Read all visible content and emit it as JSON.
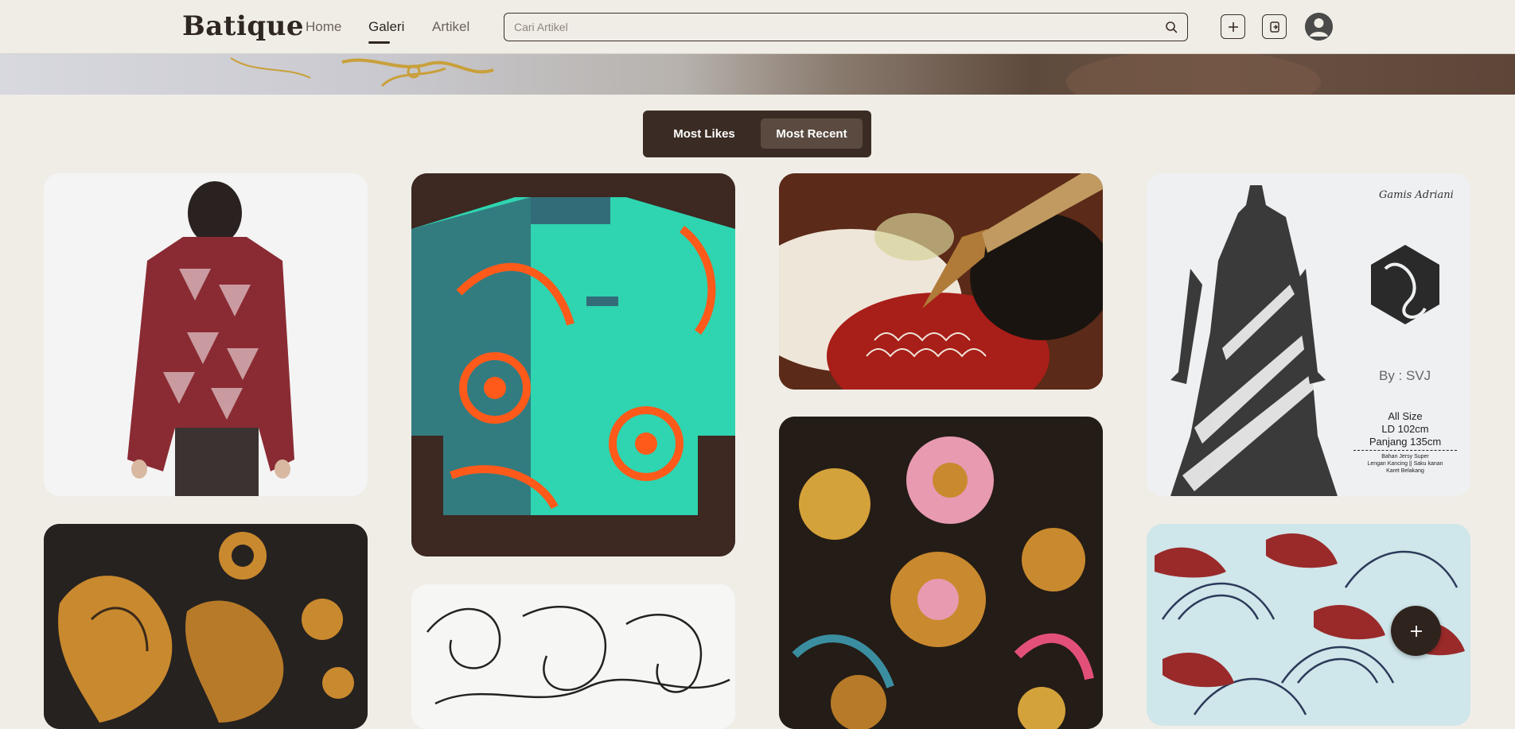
{
  "header": {
    "logo": "Batique",
    "nav": [
      {
        "label": "Home",
        "active": false
      },
      {
        "label": "Galeri",
        "active": true
      },
      {
        "label": "Artikel",
        "active": false
      }
    ],
    "search": {
      "placeholder": "Cari Artikel",
      "value": ""
    }
  },
  "sort": {
    "options": [
      "Most Likes",
      "Most Recent"
    ],
    "active": "Most Recent"
  },
  "gallery": {
    "items": [
      {
        "alt": "Red patterned batik long sleeve shirt, back view"
      },
      {
        "alt": "Turquoise and orange batik shirt"
      },
      {
        "alt": "Canting pen drawing wax batik"
      },
      {
        "alt": "Black and white batik dress product",
        "caption": {
          "brand": "Gamis Adriani",
          "by": "By : SVJ",
          "size": "All Size",
          "ld": "LD 102cm",
          "panjang": "Panjang 135cm",
          "bahan": "Bahan Jersy Super",
          "lengan": "Lengan Kancing || Saku kanan",
          "karet": "Karet Belakang"
        }
      },
      {
        "alt": "Brown and gold batik fabric"
      },
      {
        "alt": "Pencil sketch batik pattern"
      },
      {
        "alt": "Colorful floral batik fabric"
      },
      {
        "alt": "Blue and red fan pattern fabric"
      }
    ]
  },
  "colors": {
    "background": "#f0ede7",
    "dark": "#3a2c24",
    "accent": "#5a4a40"
  },
  "icons": {
    "search": "search-icon",
    "add": "plus-icon",
    "upload": "upload-icon",
    "user": "user-icon",
    "fab": "plus-icon"
  }
}
